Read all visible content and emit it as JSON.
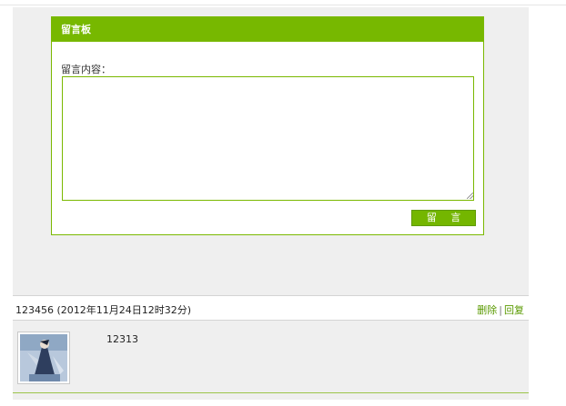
{
  "board": {
    "title": "留言板",
    "content_label": "留言内容：",
    "textarea_value": "",
    "submit_label": "留 言"
  },
  "entry": {
    "meta": "123456 (2012年11月24日12时32分)",
    "delete_label": "删除",
    "separator": "|",
    "reply_label": "回复",
    "text": "12313"
  },
  "colors": {
    "accent": "#77b800",
    "panel_bg": "#efefef"
  }
}
